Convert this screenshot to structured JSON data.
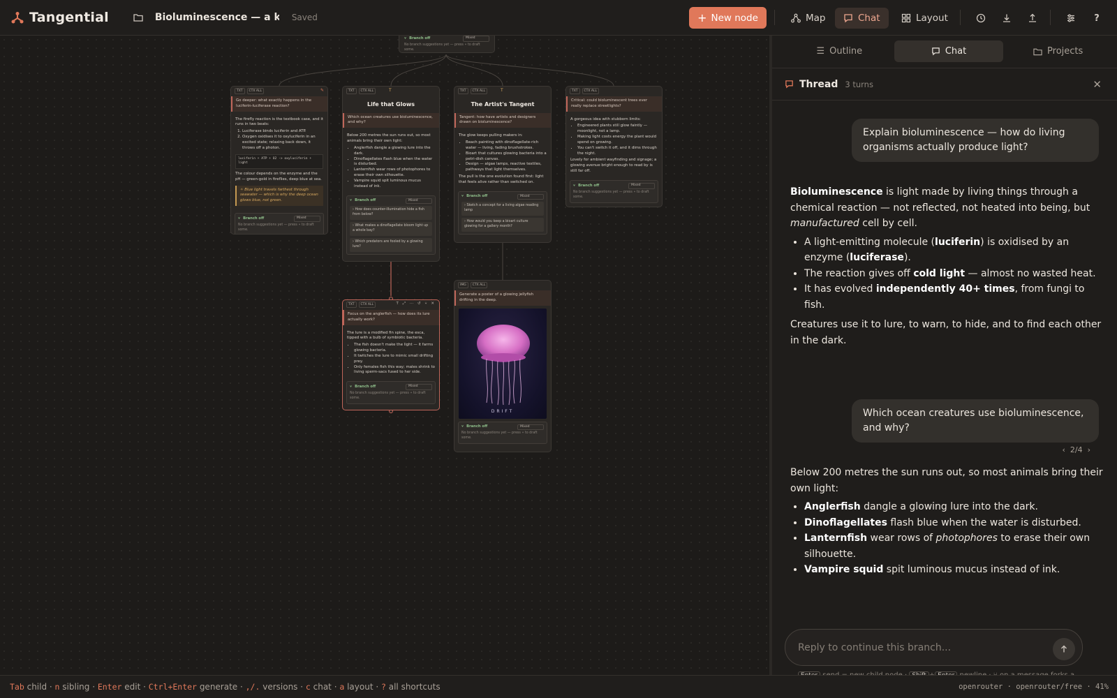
{
  "app": {
    "name": "Tangential",
    "doc_title": "Bioluminescence — a kn",
    "save_status": "Saved"
  },
  "toolbar": {
    "new_node": "New node",
    "map": "Map",
    "chat": "Chat",
    "layout": "Layout",
    "help": "?"
  },
  "canvas": {
    "top_node": {
      "branch": "Branch off",
      "mode": "Mixed",
      "note": "No branch suggestions yet — press ⑂ to draft some."
    },
    "node_firefly": {
      "tags": [
        "TXT",
        "CTX ALL"
      ],
      "prompt": "Go deeper: what exactly happens in the luciferin-luciferase reaction?",
      "intro": "The firefly reaction is the textbook case, and it runs in two beats:",
      "step1": "Luciferase binds luciferin and ATP.",
      "step2": "Oxygen oxidises it to oxyluciferin in an excited state; relaxing back down, it throws off a photon.",
      "code": "luciferin + ATP + O2  ->  oxyluciferin + light",
      "outro": "The colour depends on the enzyme and the pH — green-gold in fireflies, deep blue at sea.",
      "quote": "Blue light travels farthest through seawater — which is why the deep ocean glows blue, not green.",
      "branch": "Branch off",
      "mode": "Mixed",
      "note": "No branch suggestions yet — press ⑂ to draft some."
    },
    "node_life": {
      "tags": [
        "TXT",
        "CTX ALL"
      ],
      "title": "Life that Glows",
      "prompt": "Which ocean creatures use bioluminescence, and why?",
      "intro": "Below 200 metres the sun runs out, so most animals bring their own light:",
      "items": [
        "Anglerfish dangle a glowing lure into the dark.",
        "Dinoflagellates flash blue when the water is disturbed.",
        "Lanternfish wear rows of photophores to erase their own silhouette.",
        "Vampire squid spit luminous mucus instead of ink."
      ],
      "branch": "Branch off",
      "mode": "Mixed",
      "suggestions": [
        "How does counter-illumination hide a fish from below?",
        "What makes a dinoflagellate bloom light up a whole bay?",
        "Which predators are fooled by a glowing lure?"
      ]
    },
    "node_artist": {
      "tags": [
        "TXT",
        "CTX ALL"
      ],
      "title": "The Artist's Tangent",
      "prompt": "Tangent: how have artists and designers drawn on bioluminescence?",
      "intro": "The glow keeps pulling makers in:",
      "items": [
        "Beach painting with dinoflagellate-rich water — living, fading brushstrokes.",
        "Bioart that cultures glowing bacteria into a petri-dish canvas.",
        "Design — algae lamps, reactive textiles, pathways that light themselves."
      ],
      "outro": "The pull is the one evolution found first: light that feels alive rather than switched on.",
      "branch": "Branch off",
      "mode": "Mixed",
      "suggestions": [
        "Sketch a concept for a living algae reading lamp",
        "How would you keep a bioart culture glowing for a gallery month?"
      ]
    },
    "node_critical": {
      "tags": [
        "TXT",
        "CTX ALL"
      ],
      "prompt": "Critical: could bioluminescent trees ever really replace streetlights?",
      "intro": "A gorgeous idea with stubborn limits:",
      "items": [
        "Engineered plants still glow faintly — moonlight, not a lamp.",
        "Making light costs energy the plant would spend on growing.",
        "You can't switch it off, and it dims through the night."
      ],
      "outro": "Lovely for ambient wayfinding and signage; a glowing avenue bright enough to read by is still far off.",
      "branch": "Branch off",
      "mode": "Mixed",
      "note": "No branch suggestions yet — press ⑂ to draft some."
    },
    "node_angler": {
      "tags": [
        "TXT",
        "CTX ALL"
      ],
      "prompt": "Focus on the anglerfish — how does its lure actually work?",
      "intro": "The lure is a modified fin spine, the esca, tipped with a bulb of symbiotic bacteria.",
      "items": [
        "The fish doesn't make the light — it farms glowing bacteria.",
        "It twitches the lure to mimic small drifting prey.",
        "Only females fish this way; males shrink to living sperm-sacs fused to her side."
      ],
      "branch": "Branch off",
      "mode": "Mixed",
      "note": "No branch suggestions yet — press ⑂ to draft some."
    },
    "node_image": {
      "tags": [
        "IMG",
        "CTX ALL"
      ],
      "prompt": "Generate a poster of a glowing jellyfish drifting in the deep.",
      "image_label": "DRIFT",
      "branch": "Branch off",
      "mode": "Mixed",
      "note": "No branch suggestions yet — press ⑂ to draft some."
    }
  },
  "panel": {
    "tabs": [
      "Outline",
      "Chat",
      "Projects"
    ],
    "thread_title": "Thread",
    "turns": "3 turns",
    "user1": "Explain bioluminescence — how do living organisms actually produce light?",
    "a1": {
      "p1_b": "Bioluminescence",
      "p1_rest": " is light made by living things through a chemical reaction — not reflected, not heated into being, but ",
      "p1_i": "manufactured",
      "p1_end": " cell by cell.",
      "li1_a": "A light-emitting molecule (",
      "li1_b": "luciferin",
      "li1_c": ") is oxidised by an enzyme (",
      "li1_d": "luciferase",
      "li1_e": ").",
      "li2_a": "The reaction gives off ",
      "li2_b": "cold light",
      "li2_c": " — almost no wasted heat.",
      "li3_a": "It has evolved ",
      "li3_b": "independently 40+ times",
      "li3_c": ", from fungi to fish.",
      "p2": "Creatures use it to lure, to warn, to hide, and to find each other in the dark."
    },
    "user2": "Which ocean creatures use bioluminescence, and why?",
    "pager": "2/4",
    "a2": {
      "p1": "Below 200 metres the sun runs out, so most animals bring their own light:",
      "li1_b": "Anglerfish",
      "li1_c": " dangle a glowing lure into the dark.",
      "li2_b": "Dinoflagellates",
      "li2_c": " flash blue when the water is disturbed.",
      "li3_b": "Lanternfish",
      "li3_c": " wear rows of ",
      "li3_i": "photophores",
      "li3_d": " to erase their own silhouette.",
      "li4_b": "Vampire squid",
      "li4_c": " spit luminous mucus instead of ink."
    },
    "reply_placeholder": "Reply to continue this branch...",
    "hint": {
      "k1": "Enter",
      "t1": " send = new child node · ",
      "k2": "Shift",
      "plus": "+",
      "k3": "Enter",
      "t2": " newline · ⑂ on a message forks a sibling"
    }
  },
  "statusbar": {
    "s": [
      {
        "k": "Tab",
        "t": " child · "
      },
      {
        "k": "n",
        "t": " sibling · "
      },
      {
        "k": "Enter",
        "t": " edit · "
      },
      {
        "k": "Ctrl+Enter",
        "t": " generate · "
      },
      {
        "k": ",/.",
        "t": " versions · "
      },
      {
        "k": "c",
        "t": " chat · "
      },
      {
        "k": "a",
        "t": " layout · "
      },
      {
        "k": "?",
        "t": " all shortcuts"
      }
    ],
    "model": "openrouter · openrouter/free · 41%"
  },
  "colors": {
    "accent": "#e0785a",
    "branch_green": "#8fbf8a",
    "quote_gold": "#d8a960"
  }
}
